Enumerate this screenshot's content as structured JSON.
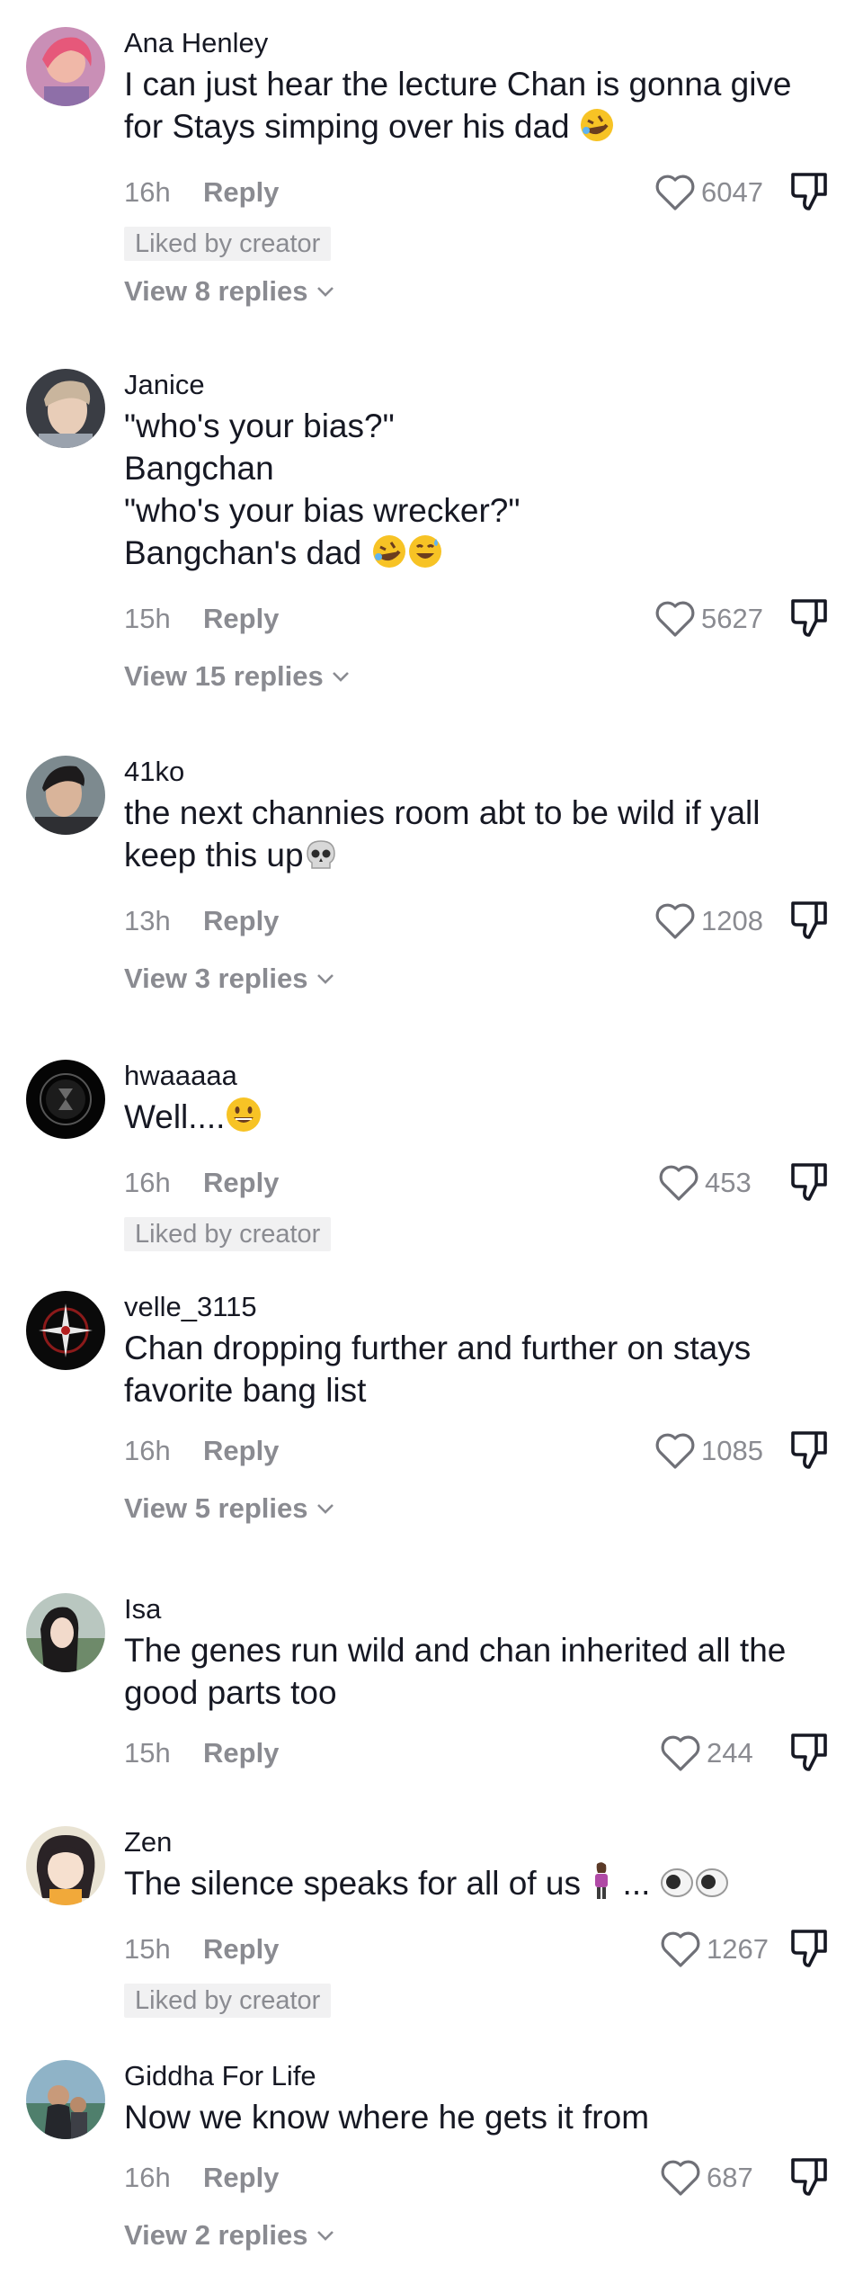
{
  "reply_label": "Reply",
  "comments": [
    {
      "username": "Ana Henley",
      "text": "I can just hear the lecture Chan is gonna give for Stays simping over his dad",
      "time": "16h",
      "likes": "6047",
      "badge": "Liked by creator",
      "view_replies": "View 8 replies"
    },
    {
      "username": "Janice",
      "text": "\"who's your bias?\"\nBangchan\n\"who's your bias wrecker?\"\nBangchan's dad",
      "time": "15h",
      "likes": "5627",
      "view_replies": "View 15 replies"
    },
    {
      "username": "41ko",
      "text": "the next channies room abt to be wild if yall keep this up",
      "time": "13h",
      "likes": "1208",
      "view_replies": "View 3 replies"
    },
    {
      "username": "hwaaaaa",
      "text": "Well....",
      "time": "16h",
      "likes": "453",
      "badge": "Liked by creator"
    },
    {
      "username": "velle_3115",
      "text": "Chan dropping further and further on stays favorite bang list",
      "time": "16h",
      "likes": "1085",
      "view_replies": "View 5 replies"
    },
    {
      "username": "Isa",
      "text": "The genes run wild and chan inherited all the good parts too",
      "time": "15h",
      "likes": "244"
    },
    {
      "username": "Zen",
      "text": "The silence speaks for all of us",
      "text_suffix": " ...",
      "time": "15h",
      "likes": "1267",
      "badge": "Liked by creator"
    },
    {
      "username": "Giddha For Life",
      "text": "Now we know where he gets it from",
      "time": "16h",
      "likes": "687",
      "view_replies": "View 2 replies"
    }
  ]
}
